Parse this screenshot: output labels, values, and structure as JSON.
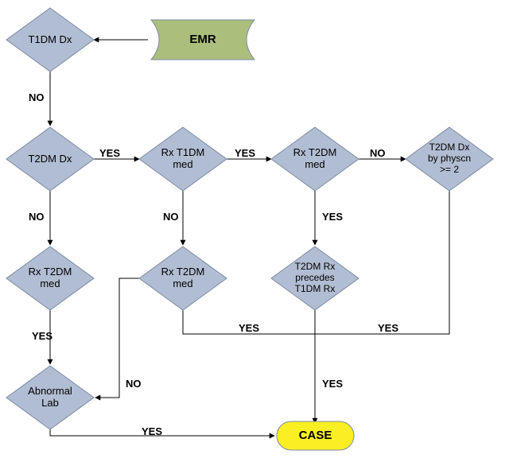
{
  "flowchart": {
    "nodes": {
      "emr": "EMR",
      "t1dm_dx": "T1DM Dx",
      "t2dm_dx": "T2DM Dx",
      "rx_t1dm_med": "Rx T1DM\nmed",
      "rx_t2dm_med_a": "Rx T2DM\nmed",
      "rx_t2dm_med_b": "Rx T2DM\nmed",
      "rx_t2dm_med_c": "Rx T2DM\nmed",
      "t2dm_dx_physcn": "T2DM Dx\nby physcn\n>= 2",
      "t2dm_rx_precedes": "T2DM Rx\nprecedes\nT1DM Rx",
      "abnormal_lab": "Abnormal\nLab",
      "case": "CASE"
    },
    "edges": {
      "t1dm_no": "NO",
      "t2dm_yes": "YES",
      "t2dm_no": "NO",
      "rxt1_yes": "YES",
      "rxt1_no": "NO",
      "rxt2a_no": "NO",
      "rxt2a_yes": "YES",
      "rxt2c_yes": "YES",
      "rxt2b_yes": "YES",
      "rxt2b_no": "NO",
      "physcn_yes": "YES",
      "precedes_yes": "YES",
      "abnormal_yes": "YES"
    }
  }
}
